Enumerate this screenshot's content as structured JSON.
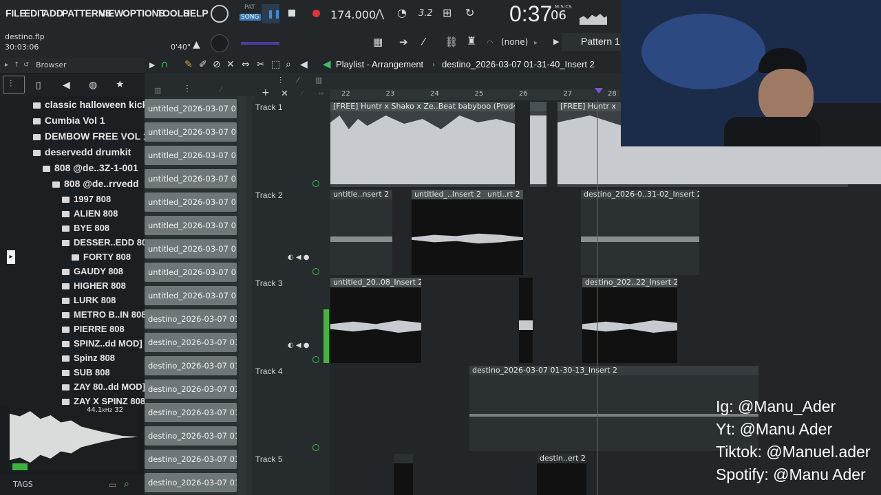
{
  "menu": [
    "FILE",
    "EDIT",
    "ADD",
    "PATTERNS",
    "VIEW",
    "OPTIONS",
    "TOOLS",
    "HELP"
  ],
  "transport": {
    "pat_label": "PAT",
    "song_label": "SONG",
    "tempo": "174.000",
    "time": "0:37",
    "time_small": "06",
    "time_unit": "M:S:CS"
  },
  "project": {
    "filename": "destino.flp",
    "duration": "30:03:06",
    "pos": "0'40\""
  },
  "toolbar2": {
    "pattern_selector": "(none)",
    "pattern_name": "Pattern 1"
  },
  "browser": {
    "title": "Browser"
  },
  "tree": [
    {
      "label": "classic halloween kick",
      "indent": 0
    },
    {
      "label": "Cumbia Vol 1",
      "indent": 0
    },
    {
      "label": "DEMBOW FREE VOL 1",
      "indent": 0
    },
    {
      "label": "deservedd drumkit",
      "indent": 0
    },
    {
      "label": "808 @de..3Z-1-001",
      "indent": 1
    },
    {
      "label": "808 @de..rrvedd",
      "indent": 2
    },
    {
      "label": "1997 808",
      "indent": 3
    },
    {
      "label": "ALIEN 808",
      "indent": 3
    },
    {
      "label": "BYE 808",
      "indent": 3
    },
    {
      "label": "DESSER..EDD 808",
      "indent": 3
    },
    {
      "label": "FORTY 808",
      "indent": 4
    },
    {
      "label": "GAUDY 808",
      "indent": 3
    },
    {
      "label": "HIGHER 808",
      "indent": 3
    },
    {
      "label": "LURK 808",
      "indent": 3
    },
    {
      "label": "METRO B..IN 808",
      "indent": 3
    },
    {
      "label": "PIERRE 808",
      "indent": 3
    },
    {
      "label": "SPINZ..dd MOD]",
      "indent": 3
    },
    {
      "label": "Spinz 808",
      "indent": 3
    },
    {
      "label": "SUB 808",
      "indent": 3
    },
    {
      "label": "ZAY 80..dd MOD]",
      "indent": 3
    },
    {
      "label": "ZAY X SPINZ 808",
      "indent": 3
    }
  ],
  "sample_info": {
    "rate": "44.1",
    "unit": "kHz",
    "bits": "32"
  },
  "tags_label": "TAGS",
  "picker": [
    "untitled_2026-03-07 01-...",
    "untitled_2026-03-07 01-...",
    "untitled_2026-03-07 01-...",
    "untitled_2026-03-07 01-...",
    "untitled_2026-03-07 01-...",
    "untitled_2026-03-07 01-...",
    "untitled_2026-03-07 01-...",
    "untitled_2026-03-07 01-...",
    "untitled_2026-03-07 01-...",
    "destino_2026-03-07 01-...",
    "destino_2026-03-07 01-...",
    "destino_2026-03-07 01-...",
    "destino_2026-03-07 01-...",
    "destino_2026-03-07 01-...",
    "destino_2026-03-07 01-...",
    "destino_2026-03-07 01-...",
    "destino_2026-03-07 01-..."
  ],
  "playlist": {
    "title": "Playlist - Arrangement",
    "current": "destino_2026-03-07 01-31-40_Insert 2"
  },
  "ruler": [
    "22",
    "23",
    "24",
    "25",
    "26",
    "27",
    "28"
  ],
  "tracks": [
    "Track 1",
    "Track 2",
    "Track 3",
    "Track 4",
    "Track 5"
  ],
  "clips": {
    "t1a": "[FREE] Huntr x Shako x Ze..Beat  babyboo (Prod420)",
    "t1b": "",
    "t1c": "[FREE] Huntr x",
    "t2a": "untitle..nsert 2",
    "t2b": "untitled_..Insert 2",
    "t2c": "unti..rt 2",
    "t2d": "destino_2026-0..31-02_Insert 2",
    "t3a": "untitled_20..08_Insert 2",
    "t3b": "destino_202..22_Insert 2",
    "t4a": "destino_2026-03-07 01-30-13_Insert 2",
    "t5a": "",
    "t5b": "destin..ert 2"
  },
  "social": [
    "Ig: @Manu_Ader",
    "Yt: @Manu Ader",
    "Tiktok: @Manuel.ader",
    "Spotify: @Manu Ader"
  ]
}
